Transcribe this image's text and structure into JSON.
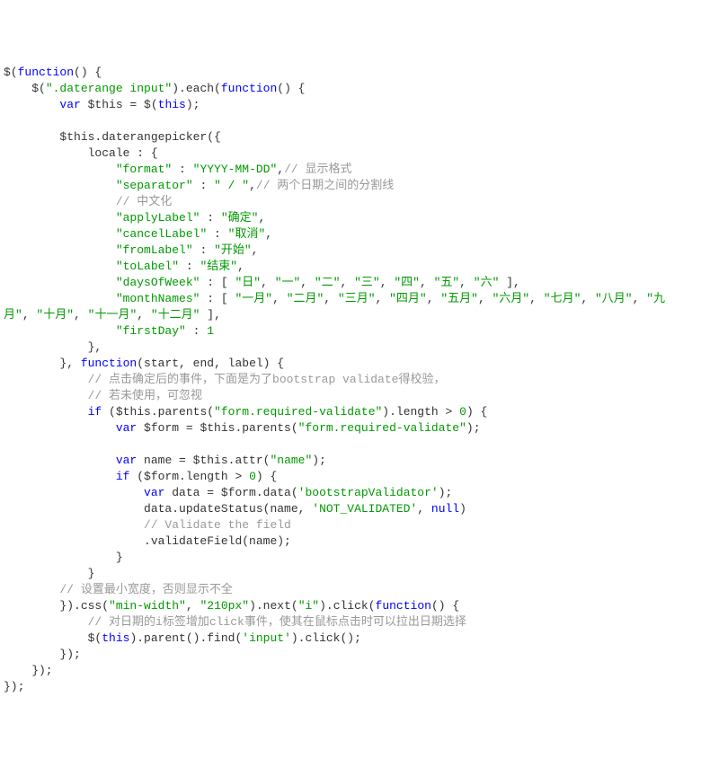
{
  "tokens": [
    {
      "t": "$(",
      "c": "punct"
    },
    {
      "t": "function",
      "c": "kw"
    },
    {
      "t": "() {",
      "c": "punct"
    },
    {
      "t": "\n",
      "c": ""
    },
    {
      "t": "    $(",
      "c": "punct"
    },
    {
      "t": "\".daterange input\"",
      "c": "string"
    },
    {
      "t": ").each(",
      "c": "punct"
    },
    {
      "t": "function",
      "c": "kw"
    },
    {
      "t": "() {",
      "c": "punct"
    },
    {
      "t": "\n",
      "c": ""
    },
    {
      "t": "        ",
      "c": ""
    },
    {
      "t": "var",
      "c": "kw"
    },
    {
      "t": " $this = $(",
      "c": "punct"
    },
    {
      "t": "this",
      "c": "kw"
    },
    {
      "t": ");",
      "c": "punct"
    },
    {
      "t": "\n",
      "c": ""
    },
    {
      "t": "\n",
      "c": ""
    },
    {
      "t": "        $this.daterangepicker({",
      "c": "punct"
    },
    {
      "t": "\n",
      "c": ""
    },
    {
      "t": "            locale : {",
      "c": "punct"
    },
    {
      "t": "\n",
      "c": ""
    },
    {
      "t": "                ",
      "c": ""
    },
    {
      "t": "\"format\"",
      "c": "string"
    },
    {
      "t": " : ",
      "c": "punct"
    },
    {
      "t": "\"YYYY-MM-DD\"",
      "c": "string"
    },
    {
      "t": ",",
      "c": "punct"
    },
    {
      "t": "// 显示格式",
      "c": "comment"
    },
    {
      "t": "\n",
      "c": ""
    },
    {
      "t": "                ",
      "c": ""
    },
    {
      "t": "\"separator\"",
      "c": "string"
    },
    {
      "t": " : ",
      "c": "punct"
    },
    {
      "t": "\" / \"",
      "c": "string"
    },
    {
      "t": ",",
      "c": "punct"
    },
    {
      "t": "// 两个日期之间的分割线",
      "c": "comment"
    },
    {
      "t": "\n",
      "c": ""
    },
    {
      "t": "                ",
      "c": ""
    },
    {
      "t": "// 中文化",
      "c": "comment"
    },
    {
      "t": "\n",
      "c": ""
    },
    {
      "t": "                ",
      "c": ""
    },
    {
      "t": "\"applyLabel\"",
      "c": "string"
    },
    {
      "t": " : ",
      "c": "punct"
    },
    {
      "t": "\"确定\"",
      "c": "string"
    },
    {
      "t": ",",
      "c": "punct"
    },
    {
      "t": "\n",
      "c": ""
    },
    {
      "t": "                ",
      "c": ""
    },
    {
      "t": "\"cancelLabel\"",
      "c": "string"
    },
    {
      "t": " : ",
      "c": "punct"
    },
    {
      "t": "\"取消\"",
      "c": "string"
    },
    {
      "t": ",",
      "c": "punct"
    },
    {
      "t": "\n",
      "c": ""
    },
    {
      "t": "                ",
      "c": ""
    },
    {
      "t": "\"fromLabel\"",
      "c": "string"
    },
    {
      "t": " : ",
      "c": "punct"
    },
    {
      "t": "\"开始\"",
      "c": "string"
    },
    {
      "t": ",",
      "c": "punct"
    },
    {
      "t": "\n",
      "c": ""
    },
    {
      "t": "                ",
      "c": ""
    },
    {
      "t": "\"toLabel\"",
      "c": "string"
    },
    {
      "t": " : ",
      "c": "punct"
    },
    {
      "t": "\"结束\"",
      "c": "string"
    },
    {
      "t": ",",
      "c": "punct"
    },
    {
      "t": "\n",
      "c": ""
    },
    {
      "t": "                ",
      "c": ""
    },
    {
      "t": "\"daysOfWeek\"",
      "c": "string"
    },
    {
      "t": " : [ ",
      "c": "punct"
    },
    {
      "t": "\"日\"",
      "c": "string"
    },
    {
      "t": ", ",
      "c": "punct"
    },
    {
      "t": "\"一\"",
      "c": "string"
    },
    {
      "t": ", ",
      "c": "punct"
    },
    {
      "t": "\"二\"",
      "c": "string"
    },
    {
      "t": ", ",
      "c": "punct"
    },
    {
      "t": "\"三\"",
      "c": "string"
    },
    {
      "t": ", ",
      "c": "punct"
    },
    {
      "t": "\"四\"",
      "c": "string"
    },
    {
      "t": ", ",
      "c": "punct"
    },
    {
      "t": "\"五\"",
      "c": "string"
    },
    {
      "t": ", ",
      "c": "punct"
    },
    {
      "t": "\"六\"",
      "c": "string"
    },
    {
      "t": " ],",
      "c": "punct"
    },
    {
      "t": "\n",
      "c": ""
    },
    {
      "t": "                ",
      "c": ""
    },
    {
      "t": "\"monthNames\"",
      "c": "string"
    },
    {
      "t": " : [ ",
      "c": "punct"
    },
    {
      "t": "\"一月\"",
      "c": "string"
    },
    {
      "t": ", ",
      "c": "punct"
    },
    {
      "t": "\"二月\"",
      "c": "string"
    },
    {
      "t": ", ",
      "c": "punct"
    },
    {
      "t": "\"三月\"",
      "c": "string"
    },
    {
      "t": ", ",
      "c": "punct"
    },
    {
      "t": "\"四月\"",
      "c": "string"
    },
    {
      "t": ", ",
      "c": "punct"
    },
    {
      "t": "\"五月\"",
      "c": "string"
    },
    {
      "t": ", ",
      "c": "punct"
    },
    {
      "t": "\"六月\"",
      "c": "string"
    },
    {
      "t": ", ",
      "c": "punct"
    },
    {
      "t": "\"七月\"",
      "c": "string"
    },
    {
      "t": ", ",
      "c": "punct"
    },
    {
      "t": "\"八月\"",
      "c": "string"
    },
    {
      "t": ", ",
      "c": "punct"
    },
    {
      "t": "\"九",
      "c": "string"
    },
    {
      "t": "\n",
      "c": ""
    },
    {
      "t": "月\"",
      "c": "string"
    },
    {
      "t": ", ",
      "c": "punct"
    },
    {
      "t": "\"十月\"",
      "c": "string"
    },
    {
      "t": ", ",
      "c": "punct"
    },
    {
      "t": "\"十一月\"",
      "c": "string"
    },
    {
      "t": ", ",
      "c": "punct"
    },
    {
      "t": "\"十二月\"",
      "c": "string"
    },
    {
      "t": " ],",
      "c": "punct"
    },
    {
      "t": "\n",
      "c": ""
    },
    {
      "t": "                ",
      "c": ""
    },
    {
      "t": "\"firstDay\"",
      "c": "string"
    },
    {
      "t": " : ",
      "c": "punct"
    },
    {
      "t": "1",
      "c": "num"
    },
    {
      "t": "\n",
      "c": ""
    },
    {
      "t": "            },",
      "c": "punct"
    },
    {
      "t": "\n",
      "c": ""
    },
    {
      "t": "        }, ",
      "c": "punct"
    },
    {
      "t": "function",
      "c": "kw"
    },
    {
      "t": "(start, end, label) {",
      "c": "punct"
    },
    {
      "t": "\n",
      "c": ""
    },
    {
      "t": "            ",
      "c": ""
    },
    {
      "t": "// 点击确定后的事件，下面是为了bootstrap validate得校验，",
      "c": "comment"
    },
    {
      "t": "\n",
      "c": ""
    },
    {
      "t": "            ",
      "c": ""
    },
    {
      "t": "// 若未使用，可忽视",
      "c": "comment"
    },
    {
      "t": "\n",
      "c": ""
    },
    {
      "t": "            ",
      "c": ""
    },
    {
      "t": "if",
      "c": "kw"
    },
    {
      "t": " ($this.parents(",
      "c": "punct"
    },
    {
      "t": "\"form.required-validate\"",
      "c": "string"
    },
    {
      "t": ").length > ",
      "c": "punct"
    },
    {
      "t": "0",
      "c": "num"
    },
    {
      "t": ") {",
      "c": "punct"
    },
    {
      "t": "\n",
      "c": ""
    },
    {
      "t": "                ",
      "c": ""
    },
    {
      "t": "var",
      "c": "kw"
    },
    {
      "t": " $form = $this.parents(",
      "c": "punct"
    },
    {
      "t": "\"form.required-validate\"",
      "c": "string"
    },
    {
      "t": ");",
      "c": "punct"
    },
    {
      "t": "\n",
      "c": ""
    },
    {
      "t": "\n",
      "c": ""
    },
    {
      "t": "                ",
      "c": ""
    },
    {
      "t": "var",
      "c": "kw"
    },
    {
      "t": " name = $this.attr(",
      "c": "punct"
    },
    {
      "t": "\"name\"",
      "c": "string"
    },
    {
      "t": ");",
      "c": "punct"
    },
    {
      "t": "\n",
      "c": ""
    },
    {
      "t": "                ",
      "c": ""
    },
    {
      "t": "if",
      "c": "kw"
    },
    {
      "t": " ($form.length > ",
      "c": "punct"
    },
    {
      "t": "0",
      "c": "num"
    },
    {
      "t": ") {",
      "c": "punct"
    },
    {
      "t": "\n",
      "c": ""
    },
    {
      "t": "                    ",
      "c": ""
    },
    {
      "t": "var",
      "c": "kw"
    },
    {
      "t": " data = $form.data(",
      "c": "punct"
    },
    {
      "t": "'bootstrapValidator'",
      "c": "string"
    },
    {
      "t": ");",
      "c": "punct"
    },
    {
      "t": "\n",
      "c": ""
    },
    {
      "t": "                    data.updateStatus(name, ",
      "c": "punct"
    },
    {
      "t": "'NOT_VALIDATED'",
      "c": "string"
    },
    {
      "t": ", ",
      "c": "punct"
    },
    {
      "t": "null",
      "c": "kw"
    },
    {
      "t": ")",
      "c": "punct"
    },
    {
      "t": "\n",
      "c": ""
    },
    {
      "t": "                    ",
      "c": ""
    },
    {
      "t": "// Validate the field",
      "c": "comment"
    },
    {
      "t": "\n",
      "c": ""
    },
    {
      "t": "                    .validateField(name);",
      "c": "punct"
    },
    {
      "t": "\n",
      "c": ""
    },
    {
      "t": "                }",
      "c": "punct"
    },
    {
      "t": "\n",
      "c": ""
    },
    {
      "t": "            }",
      "c": "punct"
    },
    {
      "t": "\n",
      "c": ""
    },
    {
      "t": "        ",
      "c": ""
    },
    {
      "t": "// 设置最小宽度，否则显示不全",
      "c": "comment"
    },
    {
      "t": "\n",
      "c": ""
    },
    {
      "t": "        }).css(",
      "c": "punct"
    },
    {
      "t": "\"min-width\"",
      "c": "string"
    },
    {
      "t": ", ",
      "c": "punct"
    },
    {
      "t": "\"210px\"",
      "c": "string"
    },
    {
      "t": ").next(",
      "c": "punct"
    },
    {
      "t": "\"i\"",
      "c": "string"
    },
    {
      "t": ").click(",
      "c": "punct"
    },
    {
      "t": "function",
      "c": "kw"
    },
    {
      "t": "() {",
      "c": "punct"
    },
    {
      "t": "\n",
      "c": ""
    },
    {
      "t": "            ",
      "c": ""
    },
    {
      "t": "// 对日期的i标签增加click事件，使其在鼠标点击时可以拉出日期选择",
      "c": "comment"
    },
    {
      "t": "\n",
      "c": ""
    },
    {
      "t": "            $(",
      "c": "punct"
    },
    {
      "t": "this",
      "c": "kw"
    },
    {
      "t": ").parent().find(",
      "c": "punct"
    },
    {
      "t": "'input'",
      "c": "string"
    },
    {
      "t": ").click();",
      "c": "punct"
    },
    {
      "t": "\n",
      "c": ""
    },
    {
      "t": "        });",
      "c": "punct"
    },
    {
      "t": "\n",
      "c": ""
    },
    {
      "t": "    });",
      "c": "punct"
    },
    {
      "t": "\n",
      "c": ""
    },
    {
      "t": "});",
      "c": "punct"
    }
  ]
}
